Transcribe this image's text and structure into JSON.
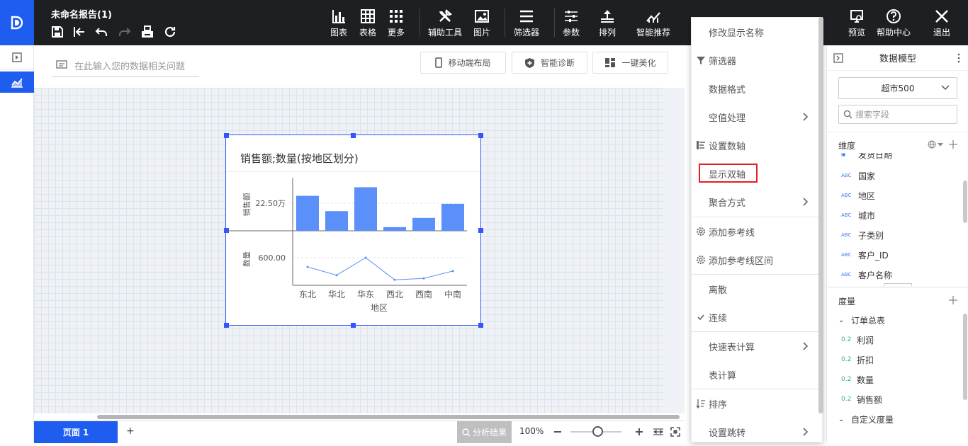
{
  "app": {
    "title": "未命名报告(1)"
  },
  "toolbar": {
    "chart": "图表",
    "table": "表格",
    "more": "更多",
    "assist": "辅助工具",
    "image": "图片",
    "filter": "筛选器",
    "params": "参数",
    "sort": "排列",
    "smart": "智能推荐",
    "preview": "预览",
    "help": "帮助中心",
    "exit": "退出"
  },
  "ask": {
    "placeholder": "在此输入您的数据相关问题"
  },
  "actions": {
    "mobile": "移动端布局",
    "diagnose": "智能诊断",
    "beautify": "一键美化"
  },
  "chart_data": {
    "type": "bar+line",
    "title": "销售额;数量(按地区划分)",
    "categories": [
      "东北",
      "华北",
      "华东",
      "西北",
      "西南",
      "中南"
    ],
    "xlabel": "地区",
    "series": [
      {
        "name": "销售额",
        "type": "bar",
        "values": [
          28.5,
          16,
          35.5,
          3,
          10.5,
          22
        ],
        "color": "#5b8ff9",
        "tick_label": "22.50万"
      },
      {
        "name": "数量",
        "type": "line",
        "values": [
          500,
          410,
          600,
          360,
          375,
          455
        ],
        "color": "#5b8ff9",
        "tick_label": "600.00"
      }
    ]
  },
  "menu": {
    "items": [
      "修改显示名称",
      "筛选器",
      "数据格式",
      "空值处理",
      "设置数轴",
      "显示双轴",
      "聚合方式",
      "添加参考线",
      "添加参考线区间",
      "离散",
      "连续",
      "快速表计算",
      "表计算",
      "排序",
      "设置跳转"
    ]
  },
  "panel": {
    "title": "数据模型",
    "dataset": "超市500",
    "search": "搜索字段",
    "dim_title": "维度",
    "dims": [
      "发货日期",
      "国家",
      "地区",
      "城市",
      "子类别",
      "客户_ID",
      "客户名称"
    ],
    "measure_title": "度量",
    "group1": "订单总表",
    "measures": [
      "利润",
      "折扣",
      "数量",
      "销售额"
    ],
    "group2": "自定义度量",
    "type_abc": "ABC",
    "type_num": "0.2"
  },
  "bottom": {
    "page": "页面 1",
    "add": "+",
    "analysis": "分析结果",
    "zoom": "100%"
  },
  "colors": {
    "accent": "#1f5cf0",
    "highlight": "#e02020"
  }
}
